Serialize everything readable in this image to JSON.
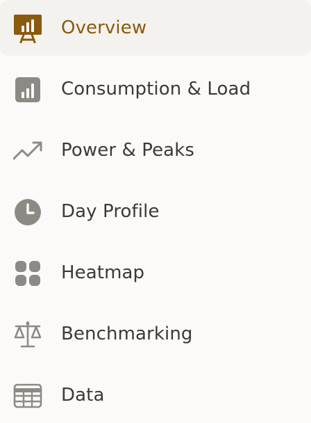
{
  "colors": {
    "active_text": "#8a5a0d",
    "active_icon": "#8a5a0d",
    "text": "#3c3a36",
    "icon": "#8c8a84",
    "active_background": "#f4f2ee",
    "background": "#fbfaf8"
  },
  "nav": {
    "items": [
      {
        "label": "Overview",
        "icon": "presentation-chart-icon",
        "active": true
      },
      {
        "label": "Consumption & Load",
        "icon": "bar-chart-icon",
        "active": false
      },
      {
        "label": "Power & Peaks",
        "icon": "trending-up-icon",
        "active": false
      },
      {
        "label": "Day Profile",
        "icon": "clock-icon",
        "active": false
      },
      {
        "label": "Heatmap",
        "icon": "grid-icon",
        "active": false
      },
      {
        "label": "Benchmarking",
        "icon": "scale-icon",
        "active": false
      },
      {
        "label": "Data",
        "icon": "table-icon",
        "active": false
      }
    ]
  }
}
